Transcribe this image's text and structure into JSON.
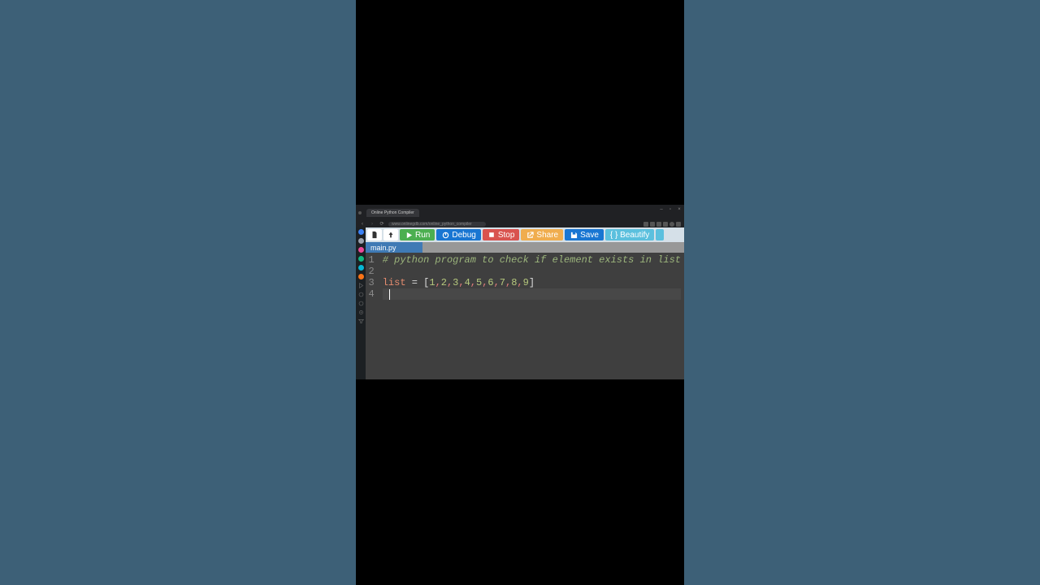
{
  "browser": {
    "tab_title": "Online Python Compiler",
    "url": "www.onlinegdb.com/online_python_compiler"
  },
  "toolbar": {
    "new_label": "",
    "upload_label": "",
    "run_label": "Run",
    "debug_label": "Debug",
    "stop_label": "Stop",
    "share_label": "Share",
    "save_label": "Save",
    "beautify_label": "{ } Beautify"
  },
  "tabs": {
    "active": "main.py"
  },
  "editor": {
    "lines": [
      "1",
      "2",
      "3",
      "4"
    ],
    "line1_comment": "# python program to check if element exists in list",
    "line3_kw": "list",
    "line3_assign": " = ",
    "line3_open": "[",
    "line3_nums": [
      "1",
      "2",
      "3",
      "4",
      "5",
      "6",
      "7",
      "8",
      "9"
    ],
    "line3_close": "]",
    "line4": " "
  },
  "sidebar_colors": [
    "#3b82f6",
    "#ec4899",
    "#10b981",
    "#06b6d4",
    "#f97316"
  ]
}
